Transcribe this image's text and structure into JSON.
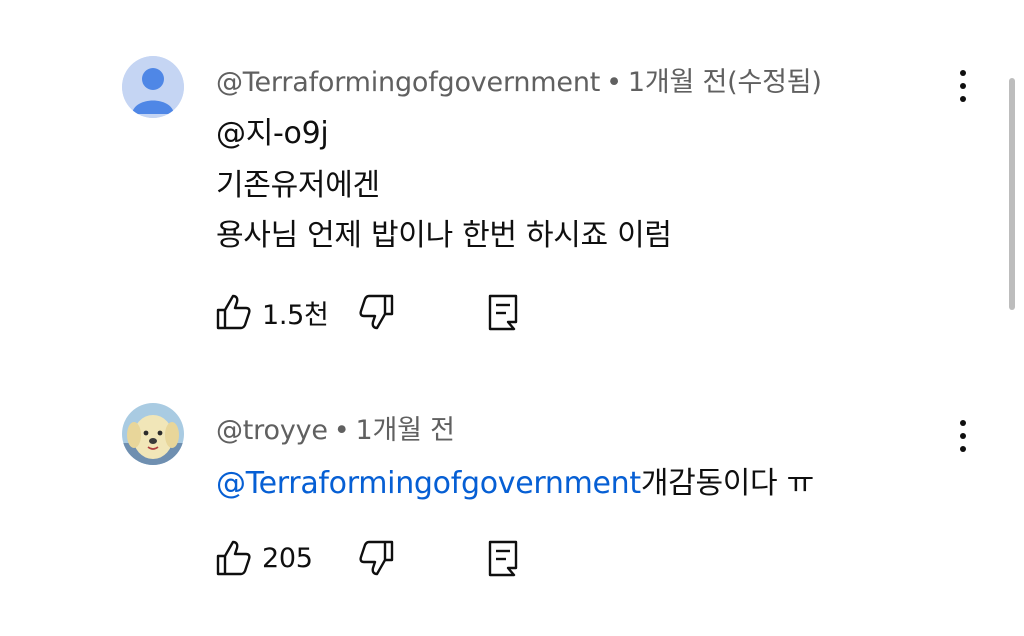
{
  "comments": [
    {
      "author": "@Terraformingofgovernment",
      "separator": "•",
      "time": "1개월 전(수정됨)",
      "mention": "@지-o9j",
      "lines": [
        "기존유저에겐",
        "용사님 언제 밥이나 한번 하시죠 이럼"
      ],
      "likes": "1.5천",
      "avatar_icon": "default-person-icon",
      "avatar_color": "#4f87e6"
    },
    {
      "author": "@troyye",
      "separator": "•",
      "time": "1개월 전",
      "mention": "@Terraformingofgovernment",
      "text": "개감동이다 ㅠ",
      "likes": "205",
      "avatar_icon": "puppy-plush-avatar",
      "avatar_color": "#a9cbe2"
    }
  ],
  "colors": {
    "mention": "#065fd4",
    "meta": "#606060",
    "text": "#0f0f0f"
  }
}
